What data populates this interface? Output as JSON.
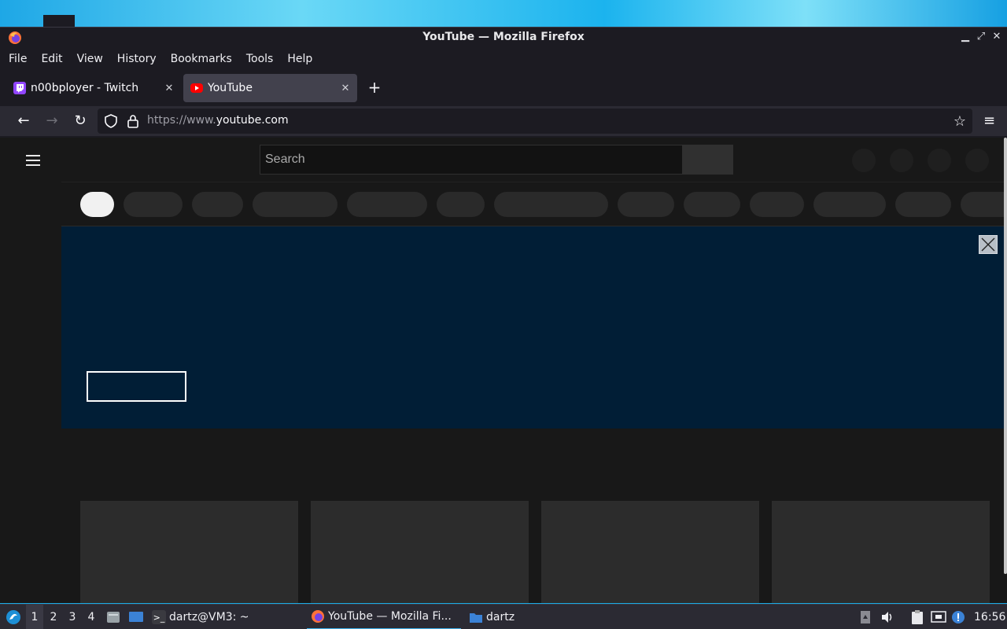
{
  "window": {
    "title": "YouTube — Mozilla Firefox",
    "controls": {
      "minimize": "▁",
      "maximize": "⤢",
      "close": "✕"
    }
  },
  "menubar": {
    "items": [
      "File",
      "Edit",
      "View",
      "History",
      "Bookmarks",
      "Tools",
      "Help"
    ]
  },
  "tabs": [
    {
      "label": "n00bployer - Twitch",
      "favicon": "twitch-icon",
      "active": false
    },
    {
      "label": "YouTube",
      "favicon": "youtube-icon",
      "active": true
    }
  ],
  "toolbar": {
    "back": "←",
    "forward": "→",
    "reload": "↻",
    "url_scheme": "https://www.",
    "url_host": "youtube.com",
    "bookmark_star": "☆",
    "app_menu": "≡",
    "new_tab": "+"
  },
  "youtube": {
    "search_placeholder": "Search"
  },
  "taskbar": {
    "workspaces": [
      "1",
      "2",
      "3",
      "4"
    ],
    "active_workspace": "1",
    "tasks": [
      {
        "label": "dartz@VM3: ~",
        "icon": "terminal-icon"
      },
      {
        "label": "YouTube — Mozilla Fi...",
        "icon": "firefox-icon"
      },
      {
        "label": "dartz",
        "icon": "folder-icon"
      }
    ],
    "clock": "16:56"
  },
  "colors": {
    "browser_bg": "#1c1b22",
    "toolbar_bg": "#2b2a33",
    "banner_bg": "#011e36",
    "accent": "#3daee9"
  }
}
